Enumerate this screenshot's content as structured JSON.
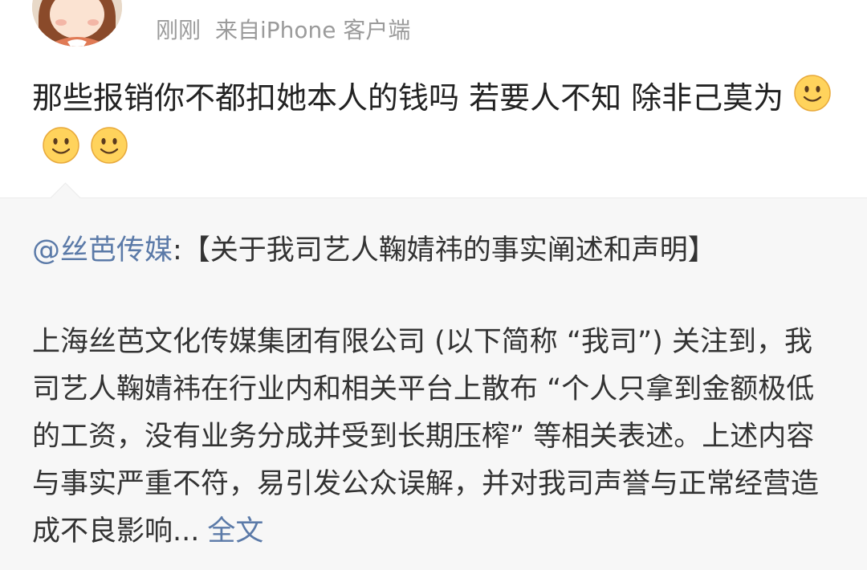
{
  "header": {
    "time": "刚刚",
    "source": "来自iPhone 客户端"
  },
  "post": {
    "text": "那些报销你不都扣她本人的钱吗  若要人不知 除非己莫为",
    "emojis": [
      "smile-emoji",
      "smile-emoji",
      "smile-emoji"
    ]
  },
  "repost": {
    "author_mention": "@丝芭传媒",
    "title": ":【关于我司艺人鞠婧祎的事实阐述和声明】",
    "body": "上海丝芭文化传媒集团有限公司 (以下简称 “我司”) 关注到，我司艺人鞠婧祎在行业内和相关平台上散布 “个人只拿到金额极低的工资，没有业务分成并受到长期压榨” 等相关表述。上述内容与事实严重不符，易引发公众误解，并对我司声誉与正常经营造成不良影响...",
    "more_label": "全文"
  },
  "colors": {
    "link": "#5b7aa8",
    "meta": "#9b9b9b",
    "text": "#222222",
    "repost_bg": "#f7f7f7"
  }
}
